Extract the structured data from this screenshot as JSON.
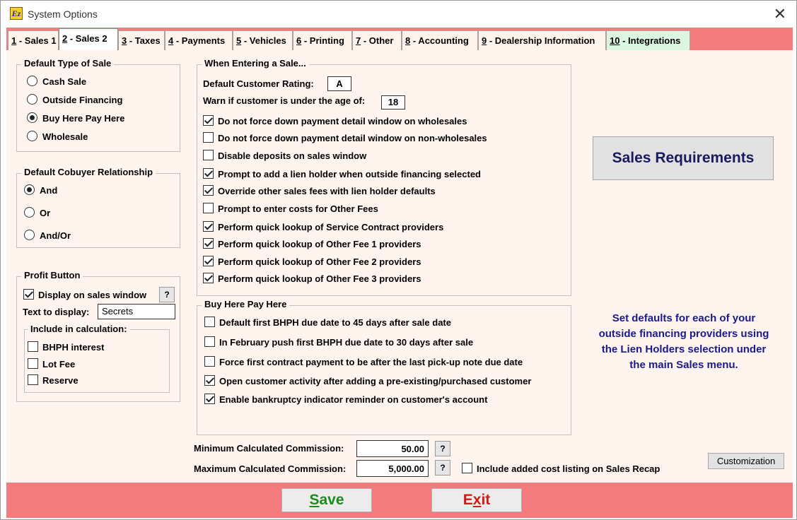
{
  "window": {
    "title": "System Options",
    "app_icon": "ez-app-icon",
    "close_icon": "close-icon"
  },
  "tabs": [
    {
      "num": "1",
      "label": " - Sales 1"
    },
    {
      "num": "2",
      "label": " - Sales 2"
    },
    {
      "num": "3",
      "label": " - Taxes"
    },
    {
      "num": "4",
      "label": " - Payments"
    },
    {
      "num": "5",
      "label": " - Vehicles"
    },
    {
      "num": "6",
      "label": " - Printing"
    },
    {
      "num": "7",
      "label": " - Other"
    },
    {
      "num": "8",
      "label": " - Accounting"
    },
    {
      "num": "9",
      "label": " - Dealership Information"
    },
    {
      "num": "10",
      "label": " - Integrations"
    }
  ],
  "default_type": {
    "title": "Default Type of Sale",
    "options": [
      "Cash Sale",
      "Outside Financing",
      "Buy Here Pay Here",
      "Wholesale"
    ],
    "selected": "Buy Here Pay Here"
  },
  "cobuyer": {
    "title": "Default Cobuyer Relationship",
    "options": [
      "And",
      "Or",
      "And/Or"
    ],
    "selected": "And"
  },
  "profit": {
    "title": "Profit Button",
    "display_label": "Display on sales window",
    "display_checked": true,
    "help": "?",
    "text_label": "Text to display:",
    "text_value": "Secrets",
    "include_title": "Include in calculation:",
    "include": [
      {
        "label": "BHPH interest",
        "checked": false
      },
      {
        "label": "Lot Fee",
        "checked": false
      },
      {
        "label": "Reserve",
        "checked": false
      }
    ]
  },
  "entering": {
    "title": "When Entering a Sale...",
    "rating_label": "Default Customer Rating:",
    "rating_value": "A",
    "age_label": "Warn if customer is under the age of:",
    "age_value": "18",
    "options": [
      {
        "label": "Do not force down payment detail window on wholesales",
        "checked": true
      },
      {
        "label": "Do not force down payment detail window on non-wholesales",
        "checked": false
      },
      {
        "label": "Disable deposits on sales window",
        "checked": false
      },
      {
        "label": "Prompt to add a lien holder when outside financing selected",
        "checked": true
      },
      {
        "label": "Override other sales fees with lien holder defaults",
        "checked": true
      },
      {
        "label": "Prompt to enter costs for Other Fees",
        "checked": false
      },
      {
        "label": "Perform quick lookup of Service Contract providers",
        "checked": true
      },
      {
        "label": "Perform quick lookup of Other Fee 1 providers",
        "checked": true
      },
      {
        "label": "Perform quick lookup of Other Fee 2 providers",
        "checked": true
      },
      {
        "label": "Perform quick lookup of Other Fee 3 providers",
        "checked": true
      }
    ]
  },
  "bhph": {
    "title": "Buy Here Pay Here",
    "options": [
      {
        "label": "Default first BHPH due date to 45 days  after sale date",
        "checked": false
      },
      {
        "label": "In February push first BHPH due date to 30 days after sale",
        "checked": false
      },
      {
        "label": "Force first contract payment to be after the last pick-up note due date",
        "checked": false
      },
      {
        "label": "Open customer activity after adding a pre-existing/purchased customer",
        "checked": true
      },
      {
        "label": "Enable bankruptcy indicator reminder on customer's account",
        "checked": true
      }
    ]
  },
  "commission": {
    "min_label": "Minimum Calculated Commission:",
    "min_value": "50.00",
    "max_label": "Maximum Calculated Commission:",
    "max_value": "5,000.00",
    "help": "?",
    "recap_label": "Include added cost listing on Sales Recap",
    "recap_checked": false
  },
  "sales_requirements": "Sales Requirements",
  "info": {
    "line1": "Set defaults for each of your",
    "line2": "outside financing providers using",
    "line3": "the Lien Holders selection under",
    "line4": "the main Sales menu."
  },
  "customization": "Customization",
  "footer": {
    "save_first": "S",
    "save_rest": "ave",
    "exit_first": "E",
    "exit_mid": "x",
    "exit_rest": "it"
  },
  "colors": {
    "accent": "#f47b7e",
    "panel": "#fff4ee",
    "info_text": "#1a1a8c",
    "save": "#1f8a1f",
    "exit": "#d21a1a",
    "tab_green": "#dcf7e0"
  }
}
